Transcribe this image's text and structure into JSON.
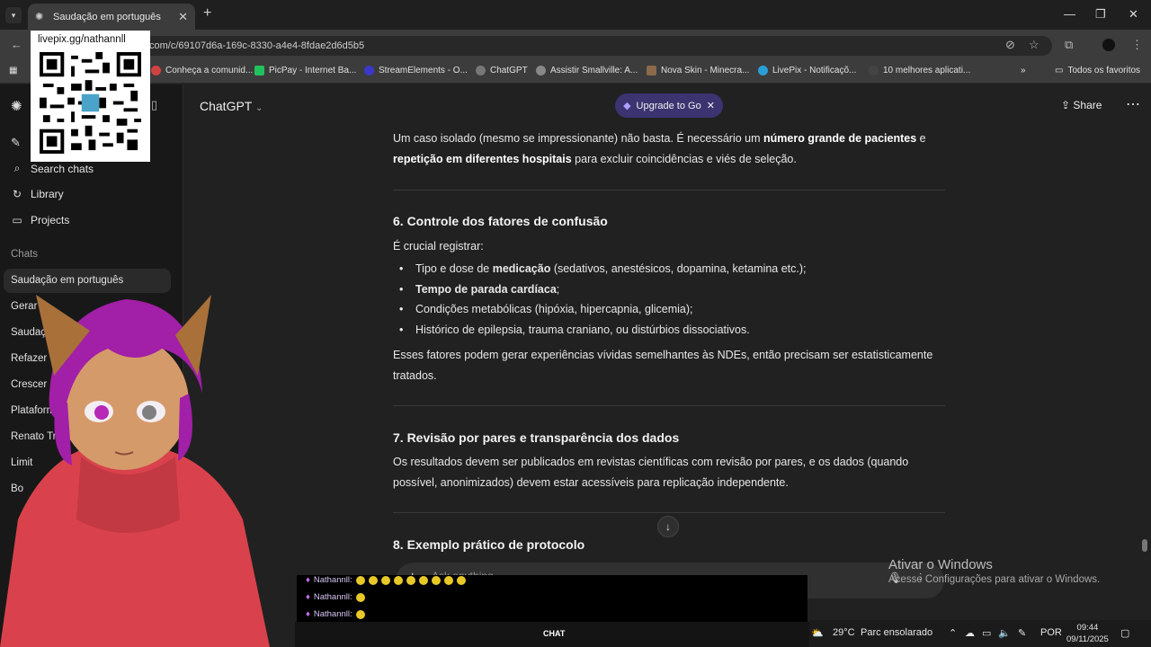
{
  "browser": {
    "tab_title": "Saudação em português",
    "new_tab": "+",
    "url": "chatgpt.com/c/69107d6a-169c-8330-a4e4-8fdae2d6d5b5",
    "url_visible": "com/c/69107d6a-169c-8330-a4e4-8fdae2d6d5b5",
    "bookmarks": [
      {
        "label": "Conheça a comunid...",
        "color": "#d04242"
      },
      {
        "label": "PicPay - Internet Ba...",
        "color": "#21c25e"
      },
      {
        "label": "StreamElements - O...",
        "color": "#3b38c9"
      },
      {
        "label": "ChatGPT",
        "color": "#777777"
      },
      {
        "label": "Assistir Smallville: A...",
        "color": "#888888"
      },
      {
        "label": "Nova Skin - Minecra...",
        "color": "#8a6a4a"
      },
      {
        "label": "LivePix - Notificaçõ...",
        "color": "#2a9fd6"
      },
      {
        "label": "10 melhores aplicati...",
        "color": "#444444"
      }
    ],
    "all_favorites": "Todos os favoritos"
  },
  "sidebar": {
    "items": [
      {
        "label": "Search chats",
        "icon": "search-icon"
      },
      {
        "label": "Library",
        "icon": "library-icon"
      },
      {
        "label": "Projects",
        "icon": "folder-icon"
      }
    ],
    "chats_heading": "Chats",
    "chats": [
      "Saudação em português",
      "Gerar",
      "Saudaç",
      "Refazer",
      "Crescer",
      "Plataform",
      "Renato Tre",
      "Limit",
      "Bo"
    ]
  },
  "header": {
    "model": "ChatGPT",
    "upgrade": "Upgrade to Go",
    "share": "Share"
  },
  "content": {
    "intro_plain1": "Um caso isolado (mesmo se impressionante) não basta. É necessário um ",
    "intro_bold1": "número grande de pacientes",
    "intro_plain2": " e ",
    "intro_bold2": "repetição em diferentes hospitais",
    "intro_plain3": " para excluir coincidências e viés de seleção.",
    "section6_title": "6. Controle dos fatores de confusão",
    "section6_lead": "É crucial registrar:",
    "bullets": [
      {
        "pre": "Tipo e dose de ",
        "bold": "medicação",
        "post": " (sedativos, anestésicos, dopamina, ketamina etc.);"
      },
      {
        "pre": "",
        "bold": "Tempo de parada cardíaca",
        "post": ";"
      },
      {
        "pre": "Condições metabólicas (hipóxia, hipercapnia, glicemia);",
        "bold": "",
        "post": ""
      },
      {
        "pre": "Histórico de epilepsia, trauma craniano, ou distúrbios dissociativos.",
        "bold": "",
        "post": ""
      }
    ],
    "section6_close": "Esses fatores podem gerar experiências vívidas semelhantes às NDEs, então precisam ser estatisticamente tratados.",
    "section7_title": "7. Revisão por pares e transparência dos dados",
    "section7_body": "Os resultados devem ser publicados em revistas científicas com revisão por pares, e os dados (quando possível, anonimizados) devem estar acessíveis para replicação independente.",
    "section8_title": "8. Exemplo prático de protocolo"
  },
  "composer": {
    "placeholder": "Ask anything"
  },
  "overlay": {
    "qr_title": "livepix.gg/nathannll",
    "watermark_title": "Ativar o Windows",
    "watermark_sub": "Acesse Configurações para ativar o Windows.",
    "chat_user": "Nathannll:",
    "chat_footer": "CHAT"
  },
  "taskbar": {
    "weather": "29°C",
    "weather_desc": "Parc ensolarado",
    "lang": "POR",
    "time": "09:44",
    "date": "09/11/2025"
  }
}
